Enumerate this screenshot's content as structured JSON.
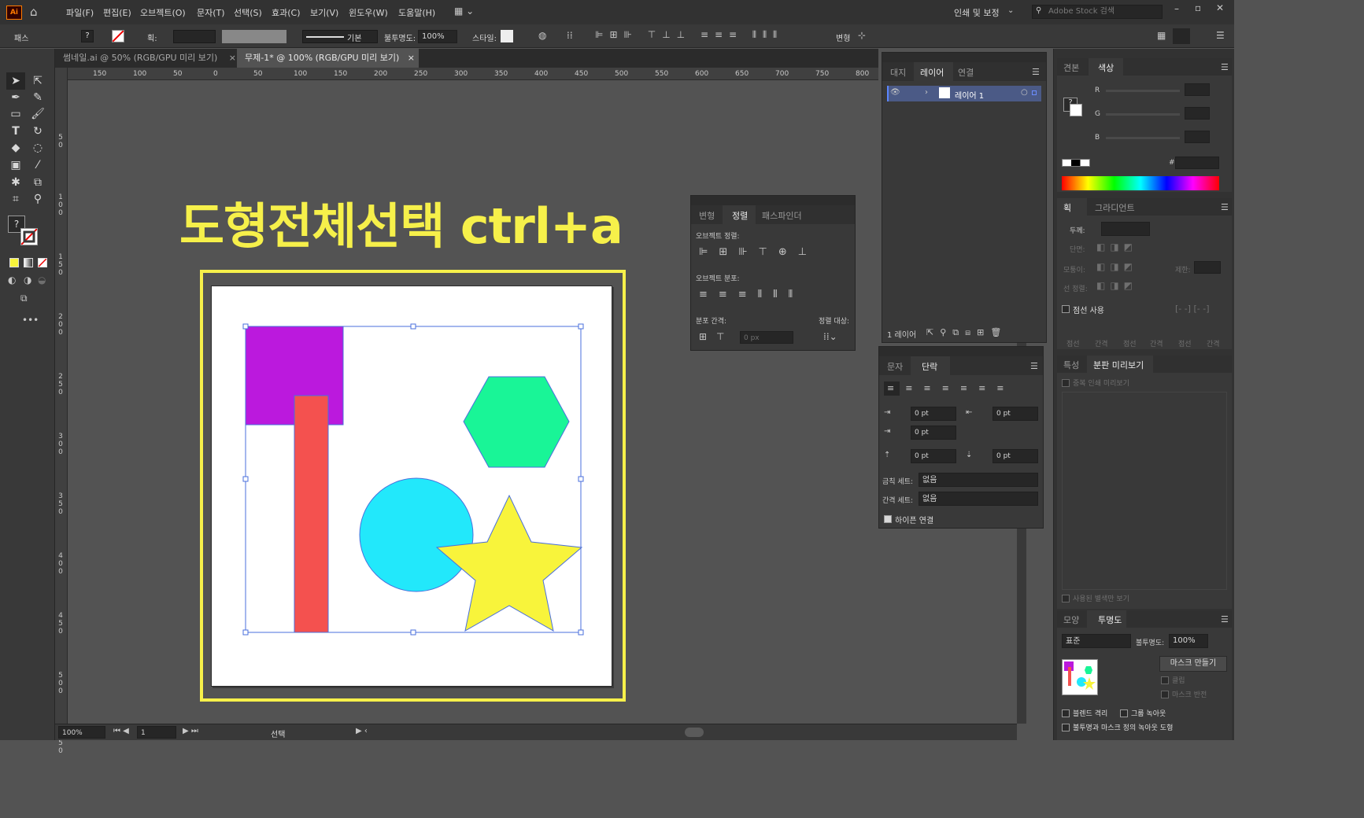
{
  "app": {
    "logo": "Ai"
  },
  "menu": [
    "파일(F)",
    "편집(E)",
    "오브젝트(O)",
    "문자(T)",
    "선택(S)",
    "효과(C)",
    "보기(V)",
    "윈도우(W)",
    "도움말(H)"
  ],
  "workspace": {
    "label": "인쇄 및 보정",
    "search_placeholder": "Adobe Stock 검색"
  },
  "control": {
    "selection_label": "패스",
    "stroke_label": "획:",
    "stroke_style": "기본",
    "opacity_label": "불투명도:",
    "opacity_value": "100%",
    "style_label": "스타일:",
    "transform_label": "변형"
  },
  "tabs": [
    {
      "label": "썸네일.ai @ 50% (RGB/GPU 미리 보기)",
      "close": "×"
    },
    {
      "label": "무제-1* @ 100% (RGB/GPU 미리 보기)",
      "close": "×"
    }
  ],
  "ruler_top": [
    "150",
    "100",
    "50",
    "0",
    "50",
    "100",
    "150",
    "200",
    "250",
    "300",
    "350",
    "400",
    "450",
    "500",
    "550",
    "600",
    "650",
    "700",
    "750",
    "800"
  ],
  "ruler_left": [
    "50",
    "100",
    "150",
    "200",
    "250",
    "300",
    "350",
    "400",
    "450",
    "500",
    "550"
  ],
  "canvas": {
    "headline": "도형전체선택 ctrl+a"
  },
  "status": {
    "zoom": "100%",
    "artboard": "1",
    "tool": "선택"
  },
  "layers_panel": {
    "tabs": [
      "대지",
      "레이어",
      "연결"
    ],
    "layer_name": "레이어 1",
    "footer": "1 레이어"
  },
  "align_panel": {
    "tabs": [
      "변형",
      "정렬",
      "패스파인더"
    ],
    "align_objects": "오브젝트 정렬:",
    "distribute_objects": "오브젝트 분포:",
    "distribute_spacing": "분포 간격:",
    "align_to": "정렬 대상:",
    "spacing_value": "0 px"
  },
  "paragraph_panel": {
    "tabs": [
      "문자",
      "단락"
    ],
    "fields": [
      "0 pt",
      "0 pt",
      "0 pt",
      "0 pt",
      "0 pt"
    ],
    "kinsoku_label": "금칙 세트:",
    "kinsoku_value": "없음",
    "mojikumi_label": "간격 세트:",
    "mojikumi_value": "없음",
    "hyphen_label": "하이픈 연결"
  },
  "color_panel": {
    "tabs": [
      "견본",
      "색상"
    ],
    "channels": [
      "R",
      "G",
      "B"
    ],
    "hash": "#"
  },
  "stroke_panel": {
    "tabs": [
      "획",
      "그라디언트"
    ],
    "weight_label": "두께:",
    "cap_label": "단면:",
    "corner_label": "모퉁이:",
    "limit_label": "제한:",
    "align_label": "선 정렬:",
    "dashed_label": "점선 사용",
    "dash_cols": [
      "점선",
      "간격",
      "점선",
      "간격",
      "점선",
      "간격"
    ]
  },
  "attr_panel": {
    "tabs": [
      "특성",
      "분판 미리보기"
    ],
    "overprint": "중복 인쇄 미리보기",
    "used_spots": "사용된 별색만 보기"
  },
  "transparency_panel": {
    "tabs": [
      "모양",
      "투명도"
    ],
    "mode": "표준",
    "opacity_label": "불투명도:",
    "opacity_value": "100%",
    "make_mask": "마스크 만들기",
    "clip": "클립",
    "invert": "마스크 반전",
    "isolate": "블렌드 격리",
    "knockout": "그룹 녹아웃",
    "opacity_mask": "불투명과 마스크 정의 녹아웃 도형"
  },
  "colors": {
    "purple": "#bb19dd",
    "red": "#f4514f",
    "green": "#19f597",
    "cyan": "#22e8fb",
    "yellow": "#f8f43b",
    "frame": "#f6f04a",
    "selection": "#4a6fdc"
  }
}
